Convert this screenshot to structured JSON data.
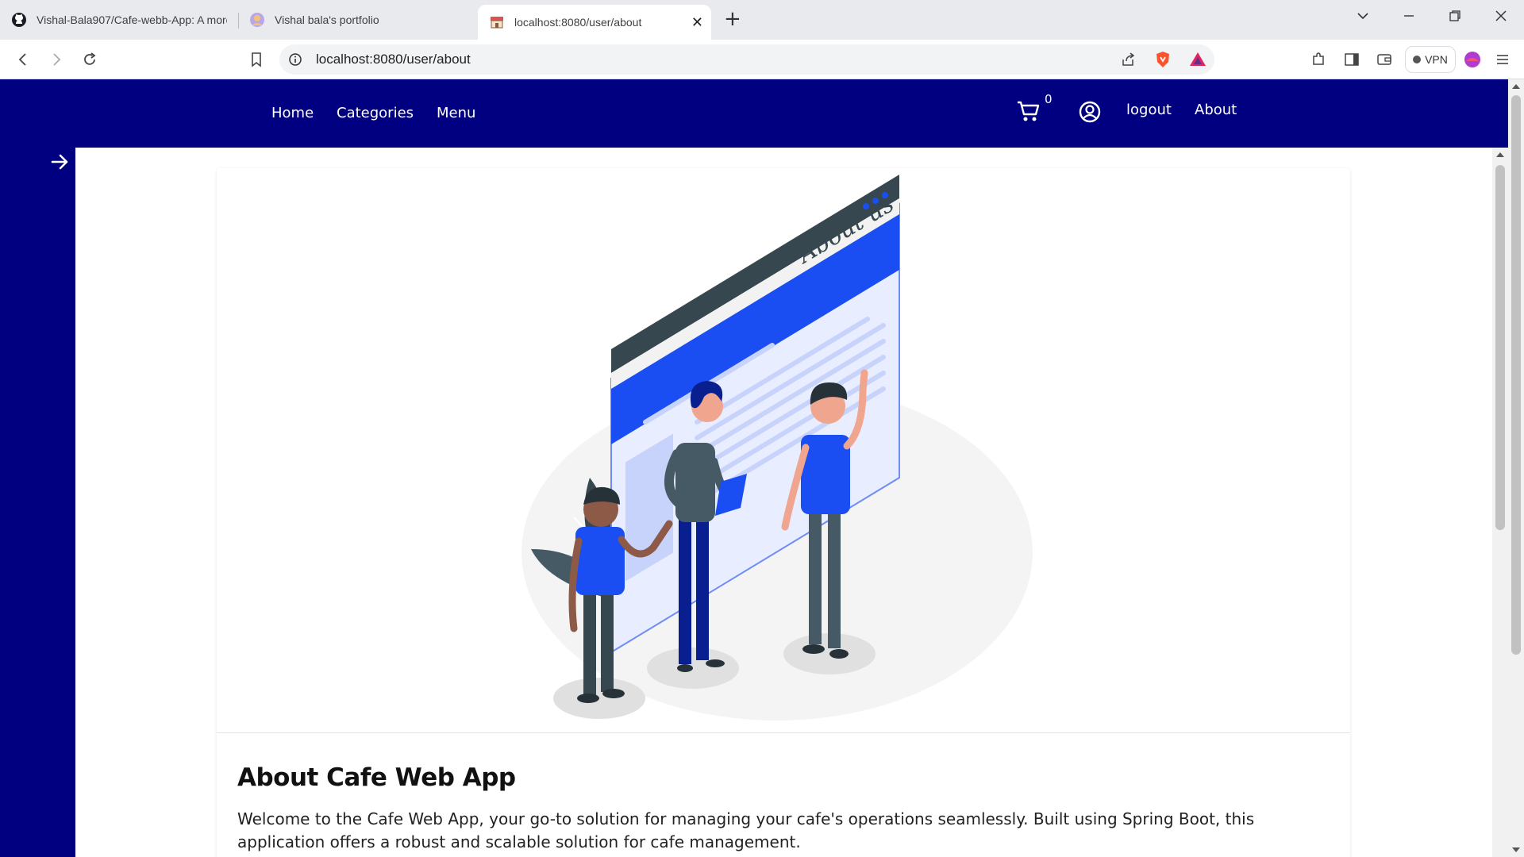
{
  "browser": {
    "tabs": [
      {
        "title": "Vishal-Bala907/Cafe-webb-App: A more",
        "icon": "github-icon"
      },
      {
        "title": "Vishal bala's portfolio",
        "icon": "avatar-icon"
      },
      {
        "title": "localhost:8080/user/about",
        "icon": "cafe-icon",
        "close": "✕"
      }
    ],
    "new_tab": "+",
    "url": "localhost:8080/user/about",
    "vpn_label": "VPN"
  },
  "app": {
    "nav": {
      "home": "Home",
      "categories": "Categories",
      "menu": "Menu",
      "cart_count": "0",
      "logout": "logout",
      "about": "About"
    },
    "about": {
      "illustration_caption": "About us",
      "title": "About Cafe Web App",
      "text": "Welcome to the Cafe Web App, your go-to solution for managing your cafe's operations seamlessly. Built using Spring Boot, this application offers a robust and scalable solution for cafe management."
    }
  },
  "colors": {
    "nav_bg": "#000080",
    "accent_blue": "#1a4ef2",
    "text": "#222222"
  }
}
